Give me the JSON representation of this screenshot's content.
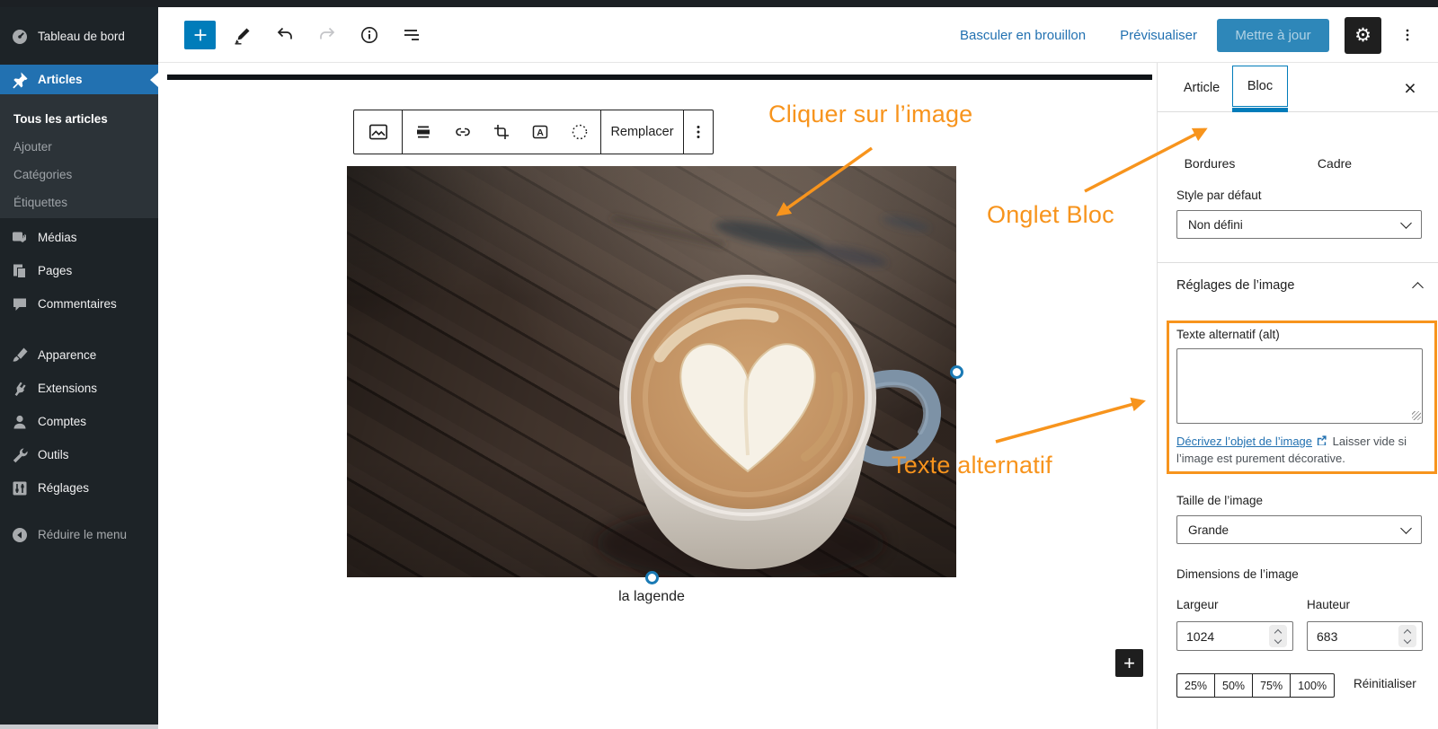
{
  "admin_sidebar": {
    "items": [
      {
        "label": "Tableau de bord",
        "icon": "dashboard-icon"
      },
      {
        "label": "Articles",
        "icon": "pin-icon",
        "active": true
      },
      {
        "label": "Médias",
        "icon": "media-icon"
      },
      {
        "label": "Pages",
        "icon": "pages-icon"
      },
      {
        "label": "Commentaires",
        "icon": "comments-icon"
      },
      {
        "label": "Apparence",
        "icon": "brush-icon"
      },
      {
        "label": "Extensions",
        "icon": "plugin-icon"
      },
      {
        "label": "Comptes",
        "icon": "users-icon"
      },
      {
        "label": "Outils",
        "icon": "tools-icon"
      },
      {
        "label": "Réglages",
        "icon": "settings-icon"
      }
    ],
    "submenu": [
      {
        "label": "Tous les articles",
        "current": true
      },
      {
        "label": "Ajouter"
      },
      {
        "label": "Catégories"
      },
      {
        "label": "Étiquettes"
      }
    ],
    "collapse_label": "Réduire le menu"
  },
  "editor_header": {
    "switch_draft": "Basculer en brouillon",
    "preview": "Prévisualiser",
    "update": "Mettre à jour"
  },
  "block_toolbar": {
    "replace_label": "Remplacer"
  },
  "canvas": {
    "caption": "la lagende"
  },
  "annotations": {
    "click_image": "Cliquer sur l’image",
    "bloc_tab": "Onglet Bloc",
    "alt_text": "Texte alternatif"
  },
  "panel": {
    "tabs": {
      "article": "Article",
      "bloc": "Bloc"
    },
    "close": "×",
    "styles": {
      "bordures": "Bordures",
      "cadre": "Cadre"
    },
    "default_style_label": "Style par défaut",
    "default_style_value": "Non défini",
    "image_settings_title": "Réglages de l’image",
    "alt_label": "Texte alternatif (alt)",
    "alt_value": "",
    "alt_help_link": "Décrivez l’objet de l’image",
    "alt_help_rest": " Laisser vide si l’image est purement décorative.",
    "size_label": "Taille de l’image",
    "size_value": "Grande",
    "dimensions_label": "Dimensions de l’image",
    "width_label": "Largeur",
    "width_value": "1024",
    "height_label": "Hauteur",
    "height_value": "683",
    "percents": [
      "25%",
      "50%",
      "75%",
      "100%"
    ],
    "reset_label": "Réinitialiser"
  },
  "colors": {
    "accent_blue": "#007cba",
    "wp_link_blue": "#2271b1",
    "annotation_orange": "#f7941d",
    "sidebar_dark": "#1d2327",
    "toolbar_black": "#1e1e1e"
  }
}
